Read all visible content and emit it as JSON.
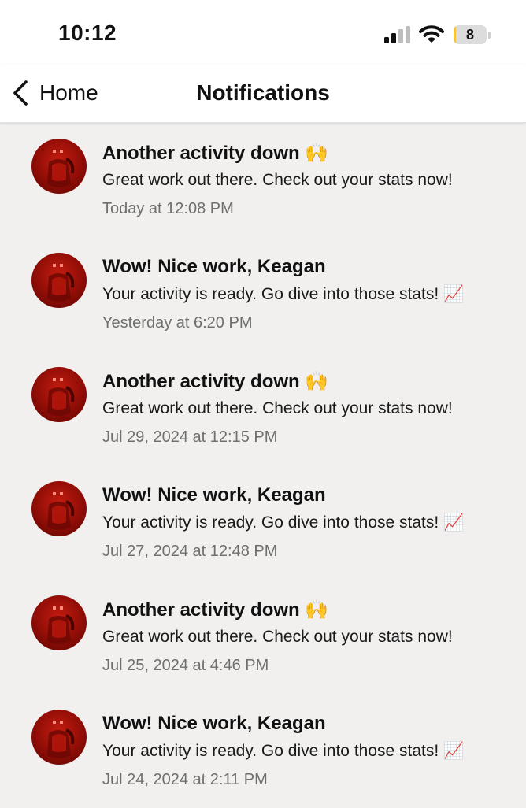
{
  "status_bar": {
    "time": "10:12",
    "battery_level": "8",
    "battery_color": "#f2c53d",
    "icons": [
      "signal-icon",
      "wifi-icon",
      "battery-icon"
    ]
  },
  "nav": {
    "back_label": "Home",
    "title": "Notifications"
  },
  "notifications": [
    {
      "title": "Another activity down 🙌",
      "body": "Great work out there. Check out your stats now!",
      "time": "Today at 12:08 PM"
    },
    {
      "title": "Wow! Nice work, Keagan",
      "body": "Your activity is ready. Go dive into those stats! 📈",
      "time": "Yesterday at 6:20 PM"
    },
    {
      "title": "Another activity down 🙌",
      "body": "Great work out there. Check out your stats now!",
      "time": "Jul 29, 2024 at 12:15 PM"
    },
    {
      "title": "Wow! Nice work, Keagan",
      "body": "Your activity is ready. Go dive into those stats! 📈",
      "time": "Jul 27, 2024 at 12:48 PM"
    },
    {
      "title": "Another activity down 🙌",
      "body": "Great work out there. Check out your stats now!",
      "time": "Jul 25, 2024 at 4:46 PM"
    },
    {
      "title": "Wow! Nice work, Keagan",
      "body": "Your activity is ready. Go dive into those stats! 📈",
      "time": "Jul 24, 2024 at 2:11 PM"
    }
  ],
  "colors": {
    "background": "#f1f0ef",
    "avatar": "#a8140b",
    "timestamp": "#6f6f6f"
  }
}
